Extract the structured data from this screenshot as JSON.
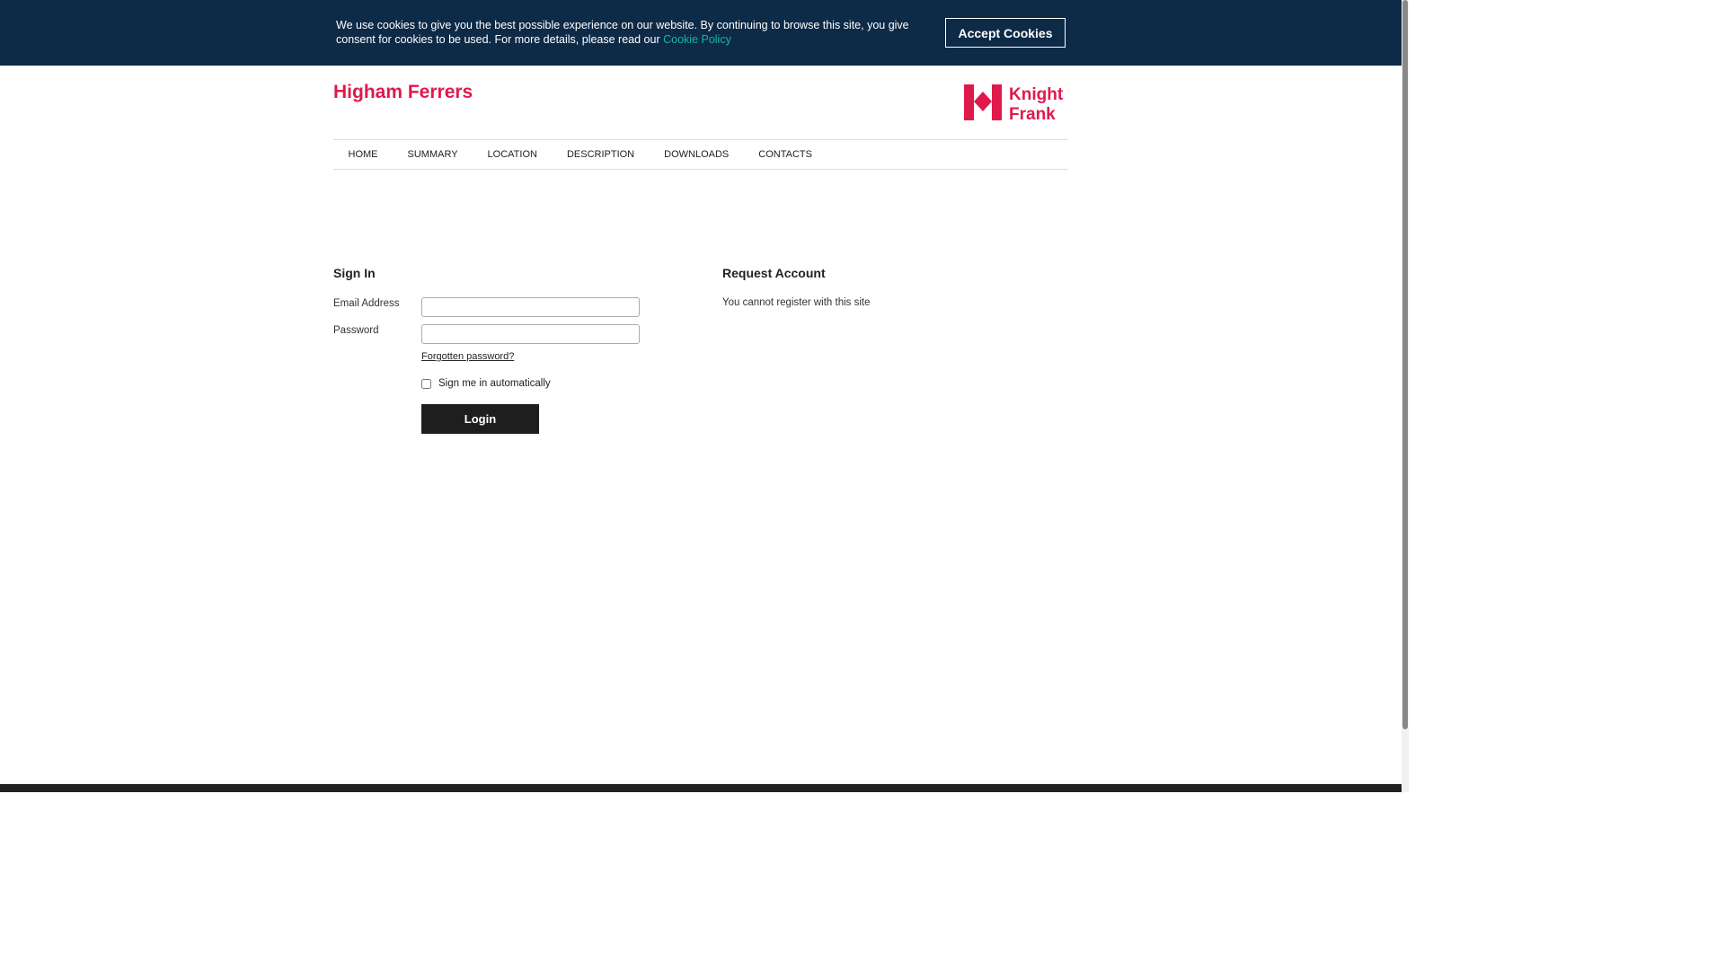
{
  "cookie": {
    "message": "We use cookies to give you the best possible experience on our website. By continuing to browse this site, you give consent for cookies to be used. For more details, please read our",
    "policy_link": "Cookie Policy",
    "accept_label": "Accept Cookies"
  },
  "header": {
    "site_title": "Higham Ferrers",
    "logo_line1": "Knight",
    "logo_line2": "Frank"
  },
  "nav": {
    "items": [
      "HOME",
      "SUMMARY",
      "LOCATION",
      "DESCRIPTION",
      "DOWNLOADS",
      "CONTACTS"
    ]
  },
  "signin": {
    "title": "Sign In",
    "email_label": "Email Address",
    "email_value": "",
    "password_label": "Password",
    "password_value": "",
    "forgot_label": "Forgotten password?",
    "remember_label": "Sign me in automatically",
    "login_label": "Login"
  },
  "request": {
    "title": "Request Account",
    "message": "You cannot register with this site"
  },
  "colors": {
    "cookie_bg": "#0d2a47",
    "brand": "#e0194b",
    "link_teal": "#18b4a8",
    "button_dark": "#1e1e1e"
  }
}
